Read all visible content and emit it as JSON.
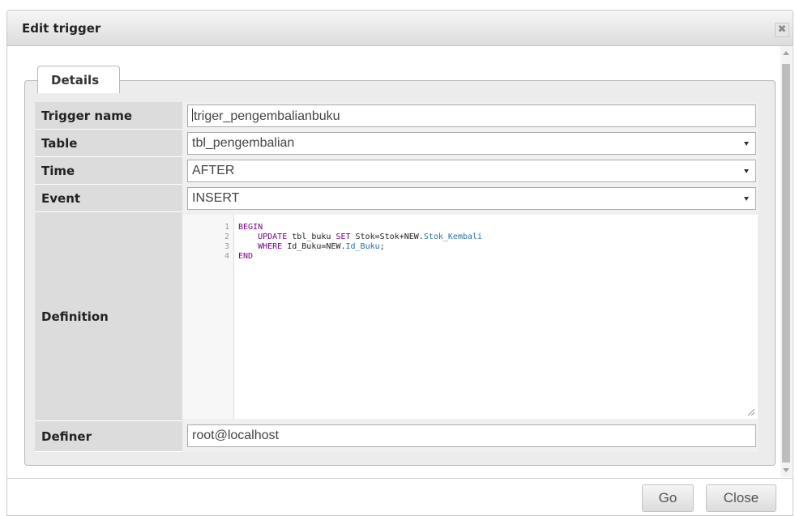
{
  "dialog": {
    "title": "Edit trigger",
    "close_glyph": "✖",
    "close_icon": "close-icon"
  },
  "details": {
    "legend": "Details",
    "rows": {
      "trigger_name": {
        "label": "Trigger name",
        "value": "triger_pengembalianbuku"
      },
      "table": {
        "label": "Table",
        "value": "tbl_pengembalian"
      },
      "time": {
        "label": "Time",
        "value": "AFTER"
      },
      "event": {
        "label": "Event",
        "value": "INSERT"
      },
      "definition": {
        "label": "Definition"
      },
      "definer": {
        "label": "Definer",
        "value": "root@localhost"
      }
    }
  },
  "definition_code": {
    "line_numbers": [
      "1",
      "2",
      "3",
      "4"
    ],
    "lines": [
      [
        {
          "t": "BEGIN",
          "c": "kw"
        }
      ],
      [
        {
          "t": "    "
        },
        {
          "t": "UPDATE",
          "c": "kw"
        },
        {
          "t": " tbl_buku "
        },
        {
          "t": "SET",
          "c": "kw"
        },
        {
          "t": " Stok=Stok+NEW."
        },
        {
          "t": "Stok_Kembali",
          "c": "var"
        }
      ],
      [
        {
          "t": "    "
        },
        {
          "t": "WHERE",
          "c": "kw"
        },
        {
          "t": " Id_Buku=NEW."
        },
        {
          "t": "Id_Buku",
          "c": "var"
        },
        {
          "t": ";"
        }
      ],
      [
        {
          "t": "END",
          "c": "kw"
        }
      ]
    ]
  },
  "footer": {
    "go_label": "Go",
    "close_label": "Close"
  },
  "colors": {
    "keyword": "#770088",
    "variable": "#1f6fa8",
    "label_bg": "#dcdcdc"
  }
}
